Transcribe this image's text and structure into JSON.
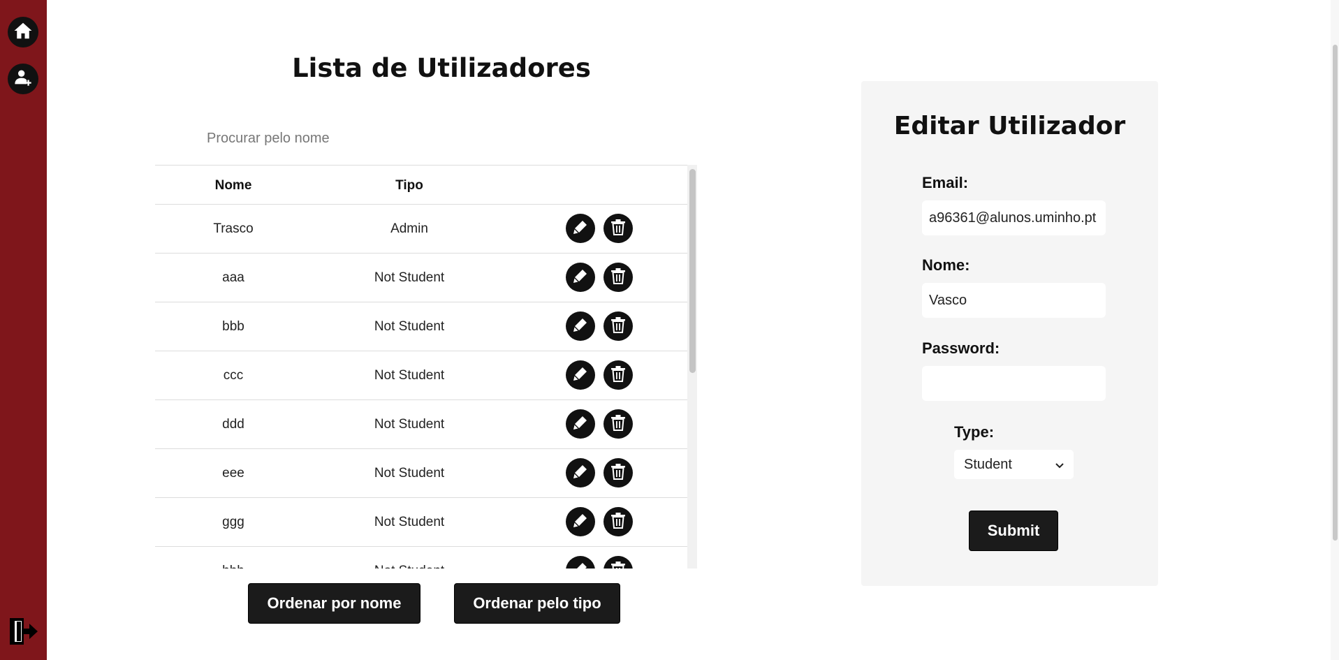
{
  "sidebar": {
    "icons": [
      "home-icon",
      "add-user-icon",
      "logout-icon"
    ]
  },
  "list": {
    "title": "Lista de Utilizadores",
    "search_placeholder": "Procurar pelo nome",
    "headers": {
      "nome": "Nome",
      "tipo": "Tipo"
    },
    "rows": [
      {
        "nome": "Trasco",
        "tipo": "Admin"
      },
      {
        "nome": "aaa",
        "tipo": "Not Student"
      },
      {
        "nome": "bbb",
        "tipo": "Not Student"
      },
      {
        "nome": "ccc",
        "tipo": "Not Student"
      },
      {
        "nome": "ddd",
        "tipo": "Not Student"
      },
      {
        "nome": "eee",
        "tipo": "Not Student"
      },
      {
        "nome": "ggg",
        "tipo": "Not Student"
      },
      {
        "nome": "hhh",
        "tipo": "Not Student"
      }
    ],
    "row_action_icons": [
      "edit-icon",
      "trash-icon"
    ],
    "sort_by_name_label": "Ordenar por nome",
    "sort_by_type_label": "Ordenar pelo tipo"
  },
  "edit_form": {
    "title": "Editar Utilizador",
    "email_label": "Email:",
    "email_value": "a96361@alunos.uminho.pt",
    "nome_label": "Nome:",
    "nome_value": "Vasco",
    "password_label": "Password:",
    "password_value": "",
    "type_label": "Type:",
    "type_selected": "Student",
    "submit_label": "Submit"
  },
  "colors": {
    "sidebar": "#7f161b",
    "button": "#1b1b1b",
    "panel": "#f5f5f5"
  }
}
